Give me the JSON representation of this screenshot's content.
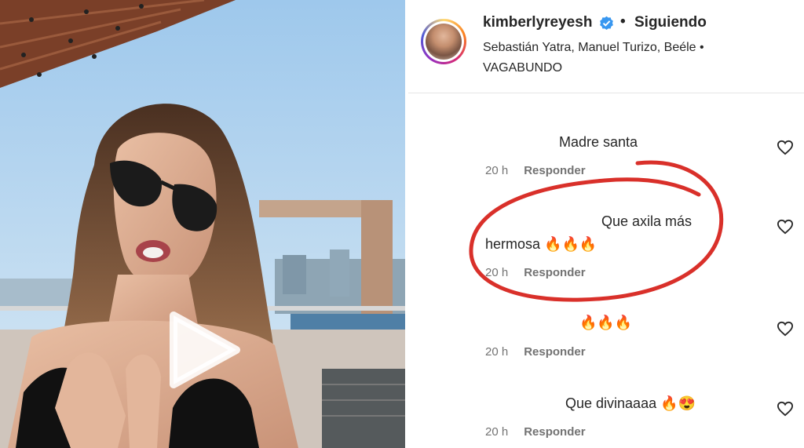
{
  "post": {
    "username": "kimberlyreyesh",
    "separator": "•",
    "follow_status": "Siguiendo",
    "music_line": "Sebastián Yatra, Manuel Turizo, Beéle • VAGABUNDO"
  },
  "icons": {
    "verified": "verified-badge-icon",
    "play": "play-icon",
    "like": "heart-icon",
    "emoji_fire": "🔥",
    "emoji_heart_eyes": "😍"
  },
  "colors": {
    "verified_blue": "#3897f0",
    "annotation_red": "#d9302a",
    "meta_gray": "#737373"
  },
  "comments": [
    {
      "text": "Madre santa",
      "time": "20 h",
      "reply": "Responder"
    },
    {
      "text_line1": "Que axila más",
      "text_line2": "hermosa 🔥🔥🔥",
      "time": "20 h",
      "reply": "Responder"
    },
    {
      "text": "🔥🔥🔥",
      "time": "20 h",
      "reply": "Responder"
    },
    {
      "text": "Que divinaaaa 🔥😍",
      "time": "20 h",
      "reply": "Responder"
    }
  ]
}
